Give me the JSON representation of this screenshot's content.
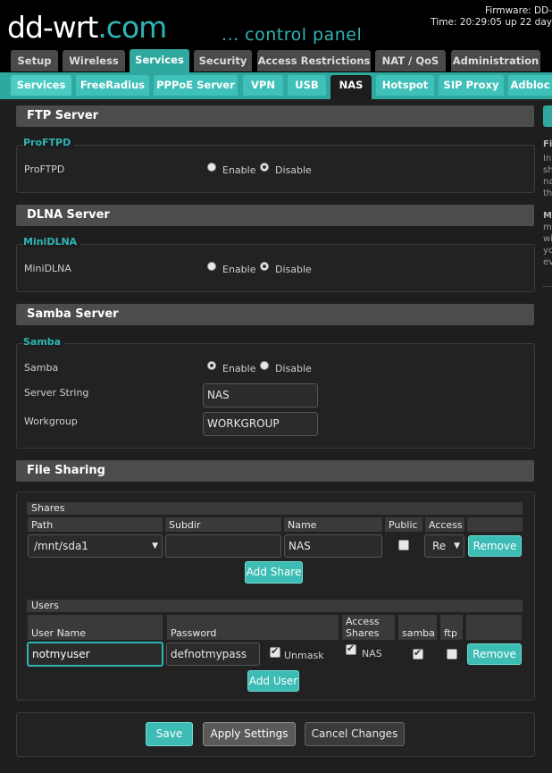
{
  "header": {
    "logo_main": "dd-wrt",
    "logo_suffix": ".com",
    "tagline": "... control panel",
    "firmware": "Firmware: DD-",
    "time": "Time: 20:29:05 up 22 day"
  },
  "tabs_main": [
    {
      "label": "Setup"
    },
    {
      "label": "Wireless"
    },
    {
      "label": "Services"
    },
    {
      "label": "Security"
    },
    {
      "label": "Access Restrictions"
    },
    {
      "label": "NAT / QoS"
    },
    {
      "label": "Administration"
    }
  ],
  "tabs_sub": [
    {
      "label": "Services"
    },
    {
      "label": "FreeRadius"
    },
    {
      "label": "PPPoE Server"
    },
    {
      "label": "VPN"
    },
    {
      "label": "USB"
    },
    {
      "label": "NAS"
    },
    {
      "label": "Hotspot"
    },
    {
      "label": "SIP Proxy"
    },
    {
      "label": "Adbloc"
    }
  ],
  "ftp": {
    "title": "FTP Server",
    "legend": "ProFTPD",
    "label": "ProFTPD",
    "enable": "Enable",
    "disable": "Disable",
    "selected": "Disable"
  },
  "dlna": {
    "title": "DLNA Server",
    "legend": "MiniDLNA",
    "label": "MiniDLNA",
    "enable": "Enable",
    "disable": "Disable",
    "selected": "Disable"
  },
  "samba": {
    "title": "Samba Server",
    "legend": "Samba",
    "label": "Samba",
    "enable": "Enable",
    "disable": "Disable",
    "selected": "Enable",
    "server_string_label": "Server String",
    "server_string_value": "NAS",
    "workgroup_label": "Workgroup",
    "workgroup_value": "WORKGROUP"
  },
  "file_sharing": {
    "title": "File Sharing",
    "shares": {
      "legend": "Shares",
      "columns": [
        "Path",
        "Subdir",
        "Name",
        "Public",
        "Access"
      ],
      "row": {
        "path": "/mnt/sda1",
        "subdir": "",
        "name": "NAS",
        "public": false,
        "access": "Re"
      },
      "remove_label": "Remove",
      "add_label": "Add Share"
    },
    "users": {
      "legend": "Users",
      "columns": [
        "User Name",
        "Password",
        "Access Shares",
        "samba",
        "ftp"
      ],
      "row": {
        "username": "notmyuser",
        "password": "defnotmypass",
        "unmask_label": "Unmask",
        "unmask": true,
        "share": "NAS",
        "share_checked": true,
        "samba": true,
        "ftp": false
      },
      "remove_label": "Remove",
      "add_label": "Add User"
    }
  },
  "footer": {
    "save": "Save",
    "apply": "Apply Settings",
    "cancel": "Cancel Changes"
  },
  "sidebar": {
    "heading1": "Fi",
    "lines1": [
      "In",
      "sh",
      "na",
      "th"
    ],
    "heading2": "M",
    "lines2": [
      "m",
      "wi",
      "yo",
      "ev"
    ]
  }
}
